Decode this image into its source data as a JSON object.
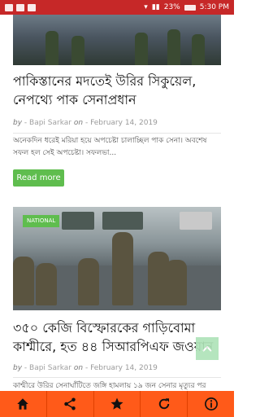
{
  "status_bar": {
    "battery": "23%",
    "time": "5:30 PM"
  },
  "articles": [
    {
      "title": "পাকিস্তানের মদতেই উরির সিকুয়েল, নেপথ্যে পাক সেনাপ্রধান",
      "by_label": "by",
      "author": "Bapi Sarkar",
      "on_label": "on",
      "date": "February 14, 2019",
      "excerpt": "অনেকদিন ধরেই মরিয়া হয়ে অপচেষ্টা চালাচ্ছিল পাক সেনা। অবশেষ সফল হল সেই অপচেষ্টা। সফলভা...",
      "read_more": "Read more"
    },
    {
      "tag": "NATIONAL",
      "title": "৩৫০ কেজি বিস্ফোরকের গাড়িবোমা কাশ্মীরে, হত ৪৪ সিআরপিএফ জওয়ান",
      "by_label": "by",
      "author": "Bapi Sarkar",
      "on_label": "on",
      "date": "February 14, 2019",
      "excerpt": "কাশ্মীরে উরির সেনাঘাঁটিতে জঙ্গি হামলায় ১৯ জন সেনার মৃত্যুর পর"
    }
  ],
  "bottom_nav": [
    "home-icon",
    "share-icon",
    "star-icon",
    "refresh-icon",
    "info-icon"
  ],
  "colors": {
    "status_bar": "#c62828",
    "bottom_nav": "#ff5a19",
    "accent_green": "#5fbd4e"
  }
}
